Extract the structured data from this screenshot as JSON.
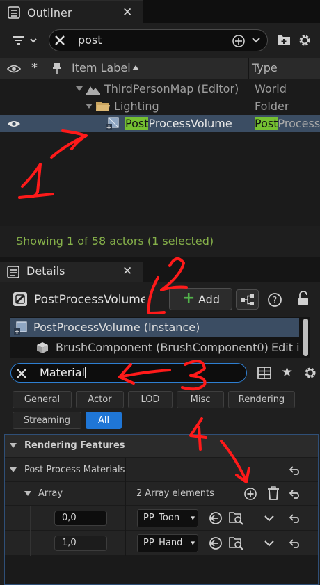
{
  "outliner": {
    "tab_title": "Outliner",
    "search_value": "post",
    "columns": {
      "label": "Item Label",
      "type": "Type"
    },
    "rows": [
      {
        "label": "ThirdPersonMap (Editor)",
        "type": "World"
      },
      {
        "label": "Lighting",
        "type": "Folder"
      },
      {
        "label_highlight": "Post",
        "label_rest": "ProcessVolume",
        "type_highlight": "Post",
        "type_rest": "Process"
      }
    ],
    "status": "Showing 1 of 58 actors (1 selected)"
  },
  "details": {
    "tab_title": "Details",
    "object_name": "PostProcessVolume",
    "add_label": "Add",
    "components": [
      {
        "label": "PostProcessVolume (Instance)"
      },
      {
        "label": "BrushComponent (BrushComponent0)",
        "extra": "Edit i"
      }
    ],
    "search_value": "Material",
    "filters": [
      "General",
      "Actor",
      "LOD",
      "Misc",
      "Rendering",
      "Streaming",
      "All"
    ],
    "active_filter": "All",
    "category": "Rendering Features",
    "property": "Post Process Materials",
    "array_label": "Array",
    "array_count": "2 Array elements",
    "elements": [
      {
        "weight": "0,0",
        "material": "PP_Toon"
      },
      {
        "weight": "1,0",
        "material": "PP_Hand"
      }
    ]
  },
  "annotations": [
    "1",
    "2",
    "3",
    "4"
  ],
  "colors": {
    "selection": "#3b4d63",
    "highlight": "#75c032",
    "status_green": "#86b14a",
    "accent_blue": "#1f76d6",
    "annotation_red": "#ff1a1a"
  }
}
